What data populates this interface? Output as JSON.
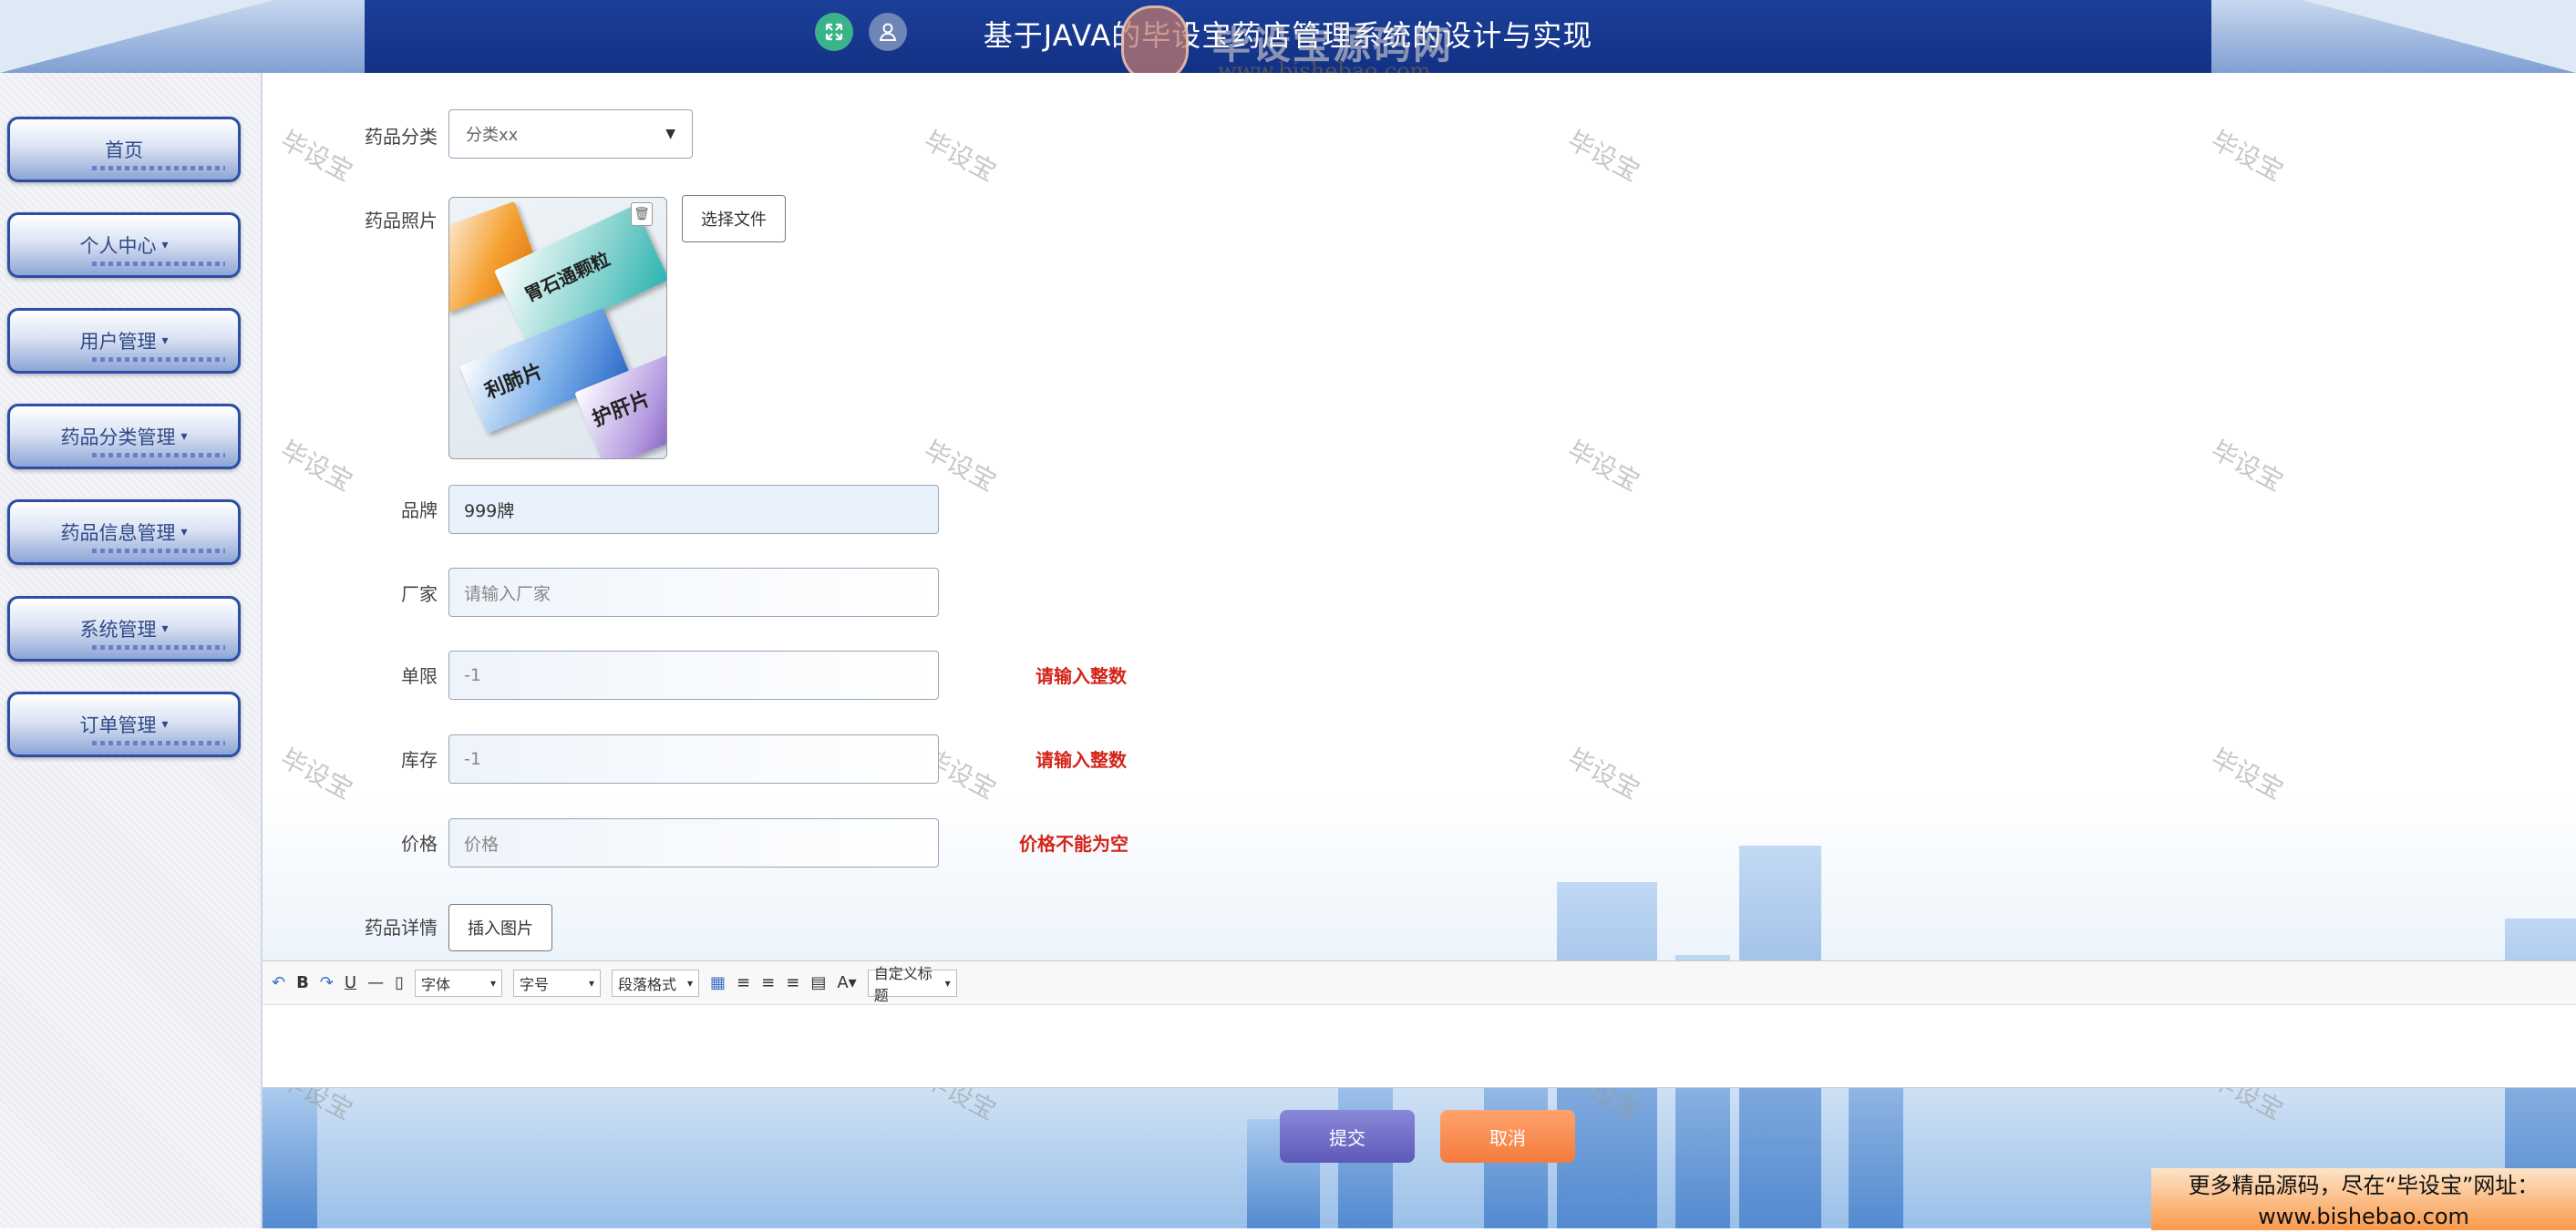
{
  "header": {
    "title": "基于JAVA的毕设宝药店管理系统的设计与实现",
    "fullscreen_icon": "expand-arrows-icon",
    "user_icon": "user-icon",
    "logo_text": "毕设宝源码网",
    "logo_url": "www.bishebao.com"
  },
  "sidebar": {
    "items": [
      {
        "label": "首页",
        "has_caret": false
      },
      {
        "label": "个人中心",
        "has_caret": true
      },
      {
        "label": "用户管理",
        "has_caret": true
      },
      {
        "label": "药品分类管理",
        "has_caret": true
      },
      {
        "label": "药品信息管理",
        "has_caret": true
      },
      {
        "label": "系统管理",
        "has_caret": true
      },
      {
        "label": "订单管理",
        "has_caret": true
      }
    ]
  },
  "watermark": "毕设宝",
  "form": {
    "category": {
      "label": "药品分类",
      "value": "分类xx"
    },
    "photo": {
      "label": "药品照片",
      "choose_button": "选择文件",
      "box_labels": [
        "胃石通颗粒",
        "利肺片",
        "护肝片"
      ]
    },
    "brand": {
      "label": "品牌",
      "value": "999牌"
    },
    "manufacturer": {
      "label": "厂家",
      "placeholder": "请输入厂家"
    },
    "limit": {
      "label": "单限",
      "value": "-1",
      "error": "请输入整数"
    },
    "stock": {
      "label": "库存",
      "value": "-1",
      "error": "请输入整数"
    },
    "price": {
      "label": "价格",
      "placeholder": "价格",
      "error": "价格不能为空"
    },
    "detail": {
      "label": "药品详情",
      "insert_button": "插入图片"
    },
    "editor_toolbar": {
      "font_family": "字体",
      "font_size": "字号",
      "paragraph": "段落格式",
      "custom_title": "自定义标题"
    },
    "submit": "提交",
    "cancel": "取消"
  },
  "promo": {
    "line1": "更多精品源码，尽在“毕设宝”网址：",
    "line2": "www.bishebao.com"
  }
}
